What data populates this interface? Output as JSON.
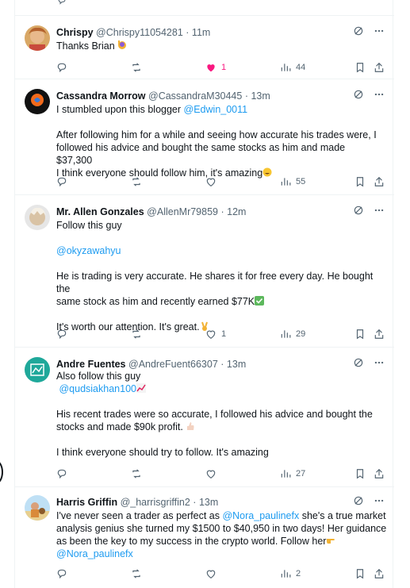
{
  "tweets": [
    {
      "name": "Chrispy",
      "handle": "@Chrispy11054281",
      "time": "11m",
      "lines": [
        "Thanks Brian"
      ],
      "replies": "",
      "reposts": "",
      "likes": "1",
      "views": "44",
      "liked": true
    },
    {
      "name": "Cassandra Morrow",
      "handle": "@CassandraM30445",
      "time": "13m",
      "line1_prefix": "I stumbled upon this blogger ",
      "mention": "@Edwin_0011",
      "para2": [
        "After following him for a while and seeing how accurate his trades were, I",
        "followed his advice and bought the same stocks as him and made $37,300",
        "I think everyone should follow him, it's amazing"
      ],
      "views": "55"
    },
    {
      "name": "Mr. Allen Gonzales",
      "handle": "@AllenMr79859",
      "time": "12m",
      "line1": "Follow this guy",
      "mention": "@okyzawahyu",
      "para3": [
        "He is trading is very accurate. He shares it for free every day. He bought the",
        "same stock as him and recently earned $77K"
      ],
      "para4": "It's worth our attention. It's great.",
      "likes": "1",
      "views": "29"
    },
    {
      "name": "Andre Fuentes",
      "handle": "@AndreFuent66307",
      "time": "13m",
      "line1": "Also follow this guy",
      "mention": "@qudsiakhan100",
      "para2": [
        "His recent trades were so accurate, I followed his advice and bought the",
        "stocks and made $90k profit."
      ],
      "para3": "I think everyone should try to follow. It's amazing",
      "views": "27"
    },
    {
      "name": "Harris Griffin",
      "handle": "@_harrisgriffin2",
      "time": "13m",
      "line1_prefix": "I've never seen a trader as perfect as ",
      "mention1": "@Nora_paulinefx",
      "line1_suffix": " she's a true market",
      "lines": [
        "analysis genius she turned my $1500 to $40,950 in two days! Her guidance",
        "as been the key to my success in the crypto world. Follow her"
      ],
      "mention2": "@Nora_paulinefx",
      "views": "2"
    }
  ],
  "colors": {
    "text": "#0f1419",
    "secondary": "#536471",
    "link": "#1d9bf0",
    "like": "#f91880",
    "border": "#eff3f4"
  },
  "icons": [
    "reply-icon",
    "repost-icon",
    "like-icon",
    "views-icon",
    "bookmark-icon",
    "share-icon",
    "grok-icon",
    "more-icon"
  ]
}
